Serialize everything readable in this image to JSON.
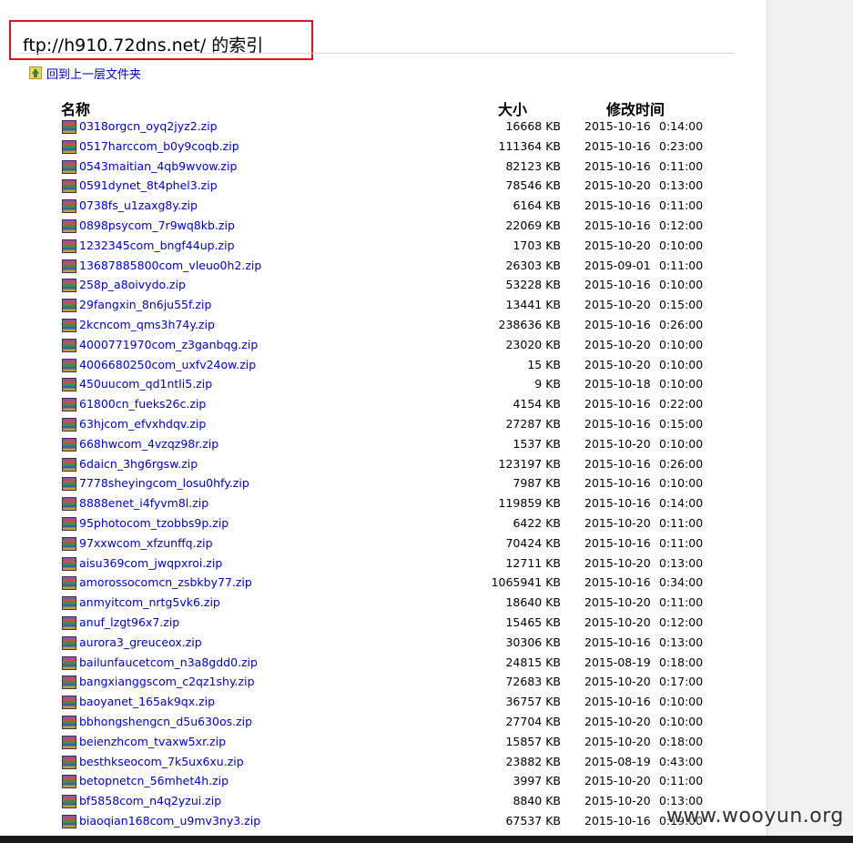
{
  "title": "ftp://h910.72dns.net/ 的索引",
  "parent_link": "回到上一层文件夹",
  "columns": {
    "name": "名称",
    "size": "大小",
    "modified": "修改时间"
  },
  "files": [
    {
      "name": "0318orgcn_oyq2jyz2.zip",
      "size": "16668 KB",
      "date": "2015-10-16",
      "time": "0:14:00"
    },
    {
      "name": "0517harccom_b0y9coqb.zip",
      "size": "111364 KB",
      "date": "2015-10-16",
      "time": "0:23:00"
    },
    {
      "name": "0543maitian_4qb9wvow.zip",
      "size": "82123 KB",
      "date": "2015-10-16",
      "time": "0:11:00"
    },
    {
      "name": "0591dynet_8t4phel3.zip",
      "size": "78546 KB",
      "date": "2015-10-20",
      "time": "0:13:00"
    },
    {
      "name": "0738fs_u1zaxg8y.zip",
      "size": "6164 KB",
      "date": "2015-10-16",
      "time": "0:11:00"
    },
    {
      "name": "0898psycom_7r9wq8kb.zip",
      "size": "22069 KB",
      "date": "2015-10-16",
      "time": "0:12:00"
    },
    {
      "name": "1232345com_bngf44up.zip",
      "size": "1703 KB",
      "date": "2015-10-20",
      "time": "0:10:00"
    },
    {
      "name": "13687885800com_vleuo0h2.zip",
      "size": "26303 KB",
      "date": "2015-09-01",
      "time": "0:11:00"
    },
    {
      "name": "258p_a8oivydo.zip",
      "size": "53228 KB",
      "date": "2015-10-16",
      "time": "0:10:00"
    },
    {
      "name": "29fangxin_8n6ju55f.zip",
      "size": "13441 KB",
      "date": "2015-10-20",
      "time": "0:15:00"
    },
    {
      "name": "2kcncom_qms3h74y.zip",
      "size": "238636 KB",
      "date": "2015-10-16",
      "time": "0:26:00"
    },
    {
      "name": "4000771970com_z3ganbqg.zip",
      "size": "23020 KB",
      "date": "2015-10-20",
      "time": "0:10:00"
    },
    {
      "name": "4006680250com_uxfv24ow.zip",
      "size": "15 KB",
      "date": "2015-10-20",
      "time": "0:10:00"
    },
    {
      "name": "450uucom_qd1ntli5.zip",
      "size": "9 KB",
      "date": "2015-10-18",
      "time": "0:10:00"
    },
    {
      "name": "61800cn_fueks26c.zip",
      "size": "4154 KB",
      "date": "2015-10-16",
      "time": "0:22:00"
    },
    {
      "name": "63hjcom_efvxhdqv.zip",
      "size": "27287 KB",
      "date": "2015-10-16",
      "time": "0:15:00"
    },
    {
      "name": "668hwcom_4vzqz98r.zip",
      "size": "1537 KB",
      "date": "2015-10-20",
      "time": "0:10:00"
    },
    {
      "name": "6daicn_3hg6rgsw.zip",
      "size": "123197 KB",
      "date": "2015-10-16",
      "time": "0:26:00"
    },
    {
      "name": "7778sheyingcom_losu0hfy.zip",
      "size": "7987 KB",
      "date": "2015-10-16",
      "time": "0:10:00"
    },
    {
      "name": "8888enet_i4fyvm8l.zip",
      "size": "119859 KB",
      "date": "2015-10-16",
      "time": "0:14:00"
    },
    {
      "name": "95photocom_tzobbs9p.zip",
      "size": "6422 KB",
      "date": "2015-10-20",
      "time": "0:11:00"
    },
    {
      "name": "97xxwcom_xfzunffq.zip",
      "size": "70424 KB",
      "date": "2015-10-16",
      "time": "0:11:00"
    },
    {
      "name": "aisu369com_jwqpxroi.zip",
      "size": "12711 KB",
      "date": "2015-10-20",
      "time": "0:13:00"
    },
    {
      "name": "amorossocomcn_zsbkby77.zip",
      "size": "1065941 KB",
      "date": "2015-10-16",
      "time": "0:34:00"
    },
    {
      "name": "anmyitcom_nrtg5vk6.zip",
      "size": "18640 KB",
      "date": "2015-10-20",
      "time": "0:11:00"
    },
    {
      "name": "anuf_lzgt96x7.zip",
      "size": "15465 KB",
      "date": "2015-10-20",
      "time": "0:12:00"
    },
    {
      "name": "aurora3_greuceox.zip",
      "size": "30306 KB",
      "date": "2015-10-16",
      "time": "0:13:00"
    },
    {
      "name": "bailunfaucetcom_n3a8gdd0.zip",
      "size": "24815 KB",
      "date": "2015-08-19",
      "time": "0:18:00"
    },
    {
      "name": "bangxianggscom_c2qz1shy.zip",
      "size": "72683 KB",
      "date": "2015-10-20",
      "time": "0:17:00"
    },
    {
      "name": "baoyanet_165ak9qx.zip",
      "size": "36757 KB",
      "date": "2015-10-16",
      "time": "0:10:00"
    },
    {
      "name": "bbhongshengcn_d5u630os.zip",
      "size": "27704 KB",
      "date": "2015-10-20",
      "time": "0:10:00"
    },
    {
      "name": "beienzhcom_tvaxw5xr.zip",
      "size": "15857 KB",
      "date": "2015-10-20",
      "time": "0:18:00"
    },
    {
      "name": "besthkseocom_7k5ux6xu.zip",
      "size": "23882 KB",
      "date": "2015-08-19",
      "time": "0:43:00"
    },
    {
      "name": "betopnetcn_56mhet4h.zip",
      "size": "3997 KB",
      "date": "2015-10-20",
      "time": "0:11:00"
    },
    {
      "name": "bf5858com_n4q2yzui.zip",
      "size": "8840 KB",
      "date": "2015-10-20",
      "time": "0:13:00"
    },
    {
      "name": "biaoqian168com_u9mv3ny3.zip",
      "size": "67537 KB",
      "date": "2015-10-16",
      "time": "0:19:00"
    }
  ],
  "watermark": "www.wooyun.org",
  "colors": {
    "link": "#0000cc",
    "highlight_border": "#e0141e"
  },
  "icons": {
    "parent": "folder-up-icon",
    "file": "zip-archive-icon"
  }
}
